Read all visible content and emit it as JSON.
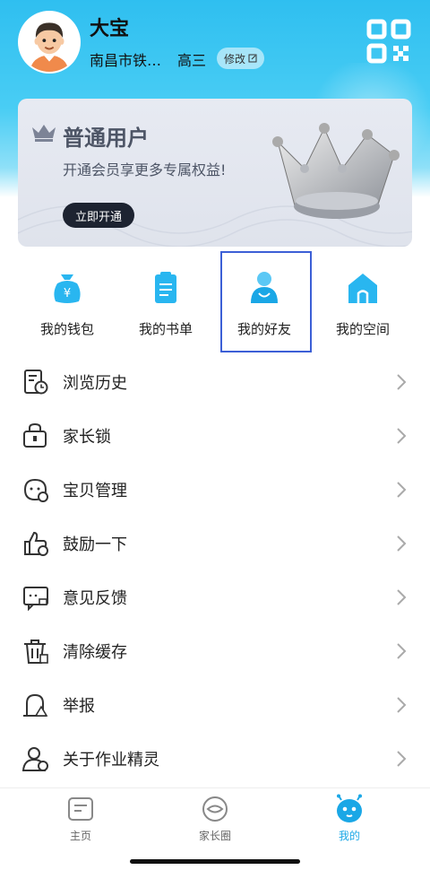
{
  "profile": {
    "name": "大宝",
    "school": "南昌市铁…",
    "grade": "高三",
    "edit_label": "修改",
    "avatar_icon": "boy-avatar",
    "qr_icon": "qr-code-icon"
  },
  "vip_card": {
    "title": "普通用户",
    "description": "开通会员享更多专属权益!",
    "button_label": "立即开通",
    "crown_icon": "crown-icon"
  },
  "quick_entries": [
    {
      "label": "我的钱包",
      "icon": "wallet-icon"
    },
    {
      "label": "我的书单",
      "icon": "booklist-icon"
    },
    {
      "label": "我的好友",
      "icon": "friend-icon"
    },
    {
      "label": "我的空间",
      "icon": "home-space-icon"
    }
  ],
  "menu": [
    {
      "label": "浏览历史",
      "icon": "history-icon"
    },
    {
      "label": "家长锁",
      "icon": "parent-lock-icon"
    },
    {
      "label": "宝贝管理",
      "icon": "baby-manage-icon"
    },
    {
      "label": "鼓励一下",
      "icon": "thumbs-up-icon"
    },
    {
      "label": "意见反馈",
      "icon": "feedback-icon"
    },
    {
      "label": "清除缓存",
      "icon": "trash-icon"
    },
    {
      "label": "举报",
      "icon": "report-icon"
    },
    {
      "label": "关于作业精灵",
      "icon": "about-icon"
    }
  ],
  "tabs": [
    {
      "label": "主页",
      "icon": "home-tab-icon",
      "active": false
    },
    {
      "label": "家长圈",
      "icon": "parent-circle-icon",
      "active": false
    },
    {
      "label": "我的",
      "icon": "mine-robot-icon",
      "active": true
    }
  ],
  "colors": {
    "header": "#2fbff0",
    "accent": "#1aa7e6",
    "highlight_box": "#3c5fd6",
    "vip_button": "#1d2331"
  }
}
